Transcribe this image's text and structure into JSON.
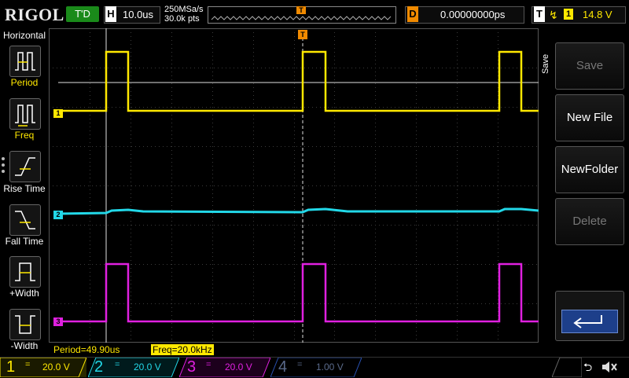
{
  "header": {
    "logo": "RIGOL",
    "trigger_status": "T'D",
    "horizontal_letter": "H",
    "timebase": "10.0us",
    "sample_rate": "250MSa/s",
    "memory_depth": "30.0k pts",
    "trigger_marker": "T",
    "delay_letter": "D",
    "delay_value": "0.00000000ps",
    "trigger_letter": "T",
    "trigger_channel": "1",
    "trigger_level": "14.8 V"
  },
  "left_panel": {
    "title": "Horizontal",
    "items": [
      {
        "label": "Period"
      },
      {
        "label": "Freq"
      },
      {
        "label": "Rise Time"
      },
      {
        "label": "Fall Time"
      },
      {
        "label": "+Width"
      },
      {
        "label": "-Width"
      }
    ]
  },
  "channel_markers": {
    "ch1": "1",
    "ch2": "2",
    "ch3": "3"
  },
  "measurements": {
    "period": "Period=49.90us",
    "freq": "Freq=20.0kHz"
  },
  "right_menu": {
    "title": "Save",
    "buttons": [
      {
        "label": "Save",
        "enabled": false
      },
      {
        "label": "New File",
        "enabled": true
      },
      {
        "label": "NewFolder",
        "enabled": true
      },
      {
        "label": "Delete",
        "enabled": false
      }
    ]
  },
  "channels": [
    {
      "num": "1",
      "coupling": "=",
      "scale": "20.0 V",
      "color": "#ffe800",
      "active": true
    },
    {
      "num": "2",
      "coupling": "=",
      "scale": "20.0 V",
      "color": "#22d8e8",
      "active": true
    },
    {
      "num": "3",
      "coupling": "=",
      "scale": "20.0 V",
      "color": "#e020e0",
      "active": true
    },
    {
      "num": "4",
      "coupling": "=",
      "scale": "1.00 V",
      "color": "#2850b0",
      "active": false
    }
  ],
  "colors": {
    "ch1": "#ffe800",
    "ch2": "#22d8e8",
    "ch3": "#e020e0",
    "ch4": "#2850b0",
    "trigger": "#f08a00",
    "run_status": "#1a8a1a"
  }
}
